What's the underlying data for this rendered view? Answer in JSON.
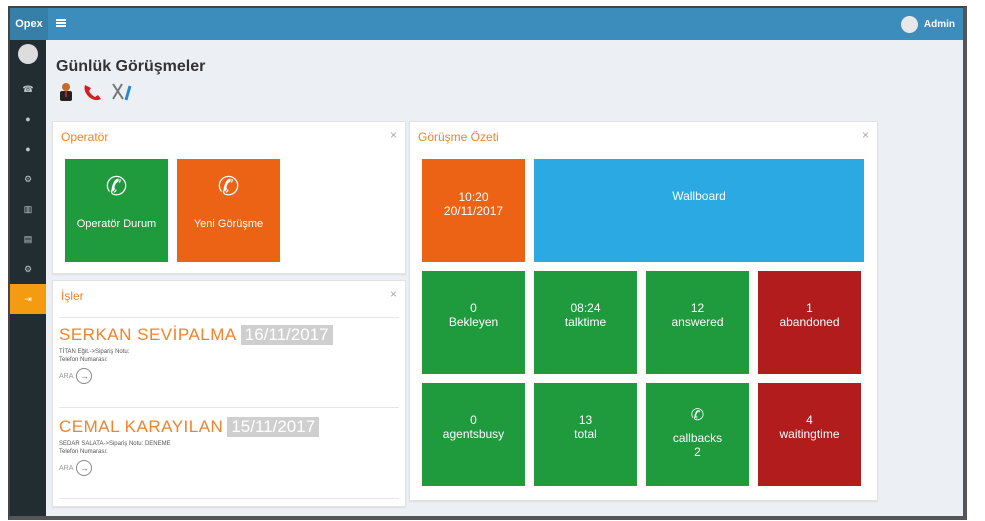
{
  "brand": "Opex",
  "user": {
    "name": "Admin"
  },
  "page": {
    "title": "Günlük Görüşmeler"
  },
  "operator_panel": {
    "title": "Operatör",
    "close": "×",
    "tiles": [
      {
        "label": "Operatör Durum",
        "icon": "phone-icon",
        "color": "#1f9a3d"
      },
      {
        "label": "Yeni Görüşme",
        "icon": "phone-icon",
        "color": "#ec6316"
      }
    ]
  },
  "jobs_panel": {
    "title": "İşler",
    "close": "×",
    "items": [
      {
        "name": "SERKAN SEVİPALMA",
        "date": "16/11/2017",
        "line1": "TİTAN Eğit.->Sipariş Notu:",
        "line2": "Telefon Numarası:",
        "action": "ARA"
      },
      {
        "name": "CEMAL KARAYILAN",
        "date": "15/11/2017",
        "line1": "SEDAR SALATA->Sipariş Notu: DENEME",
        "line2": "Telefon Numarası:",
        "action": "ARA"
      }
    ]
  },
  "summary_panel": {
    "title": "Görüşme Özeti",
    "close": "×",
    "time": "10:20",
    "date": "20/11/2017",
    "wallboard": "Wallboard",
    "stats": [
      {
        "value": "0",
        "label": "Bekleyen",
        "color": "#1f9a3d"
      },
      {
        "value": "08:24",
        "label": "talktime",
        "color": "#1f9a3d"
      },
      {
        "value": "12",
        "label": "answered",
        "color": "#1f9a3d"
      },
      {
        "value": "1",
        "label": "abandoned",
        "color": "#b21c1c"
      },
      {
        "value": "0",
        "label": "agentsbusy",
        "color": "#1f9a3d"
      },
      {
        "value": "13",
        "label": "total",
        "color": "#1f9a3d"
      },
      {
        "value": "2",
        "label": "callbacks",
        "color": "#1f9a3d",
        "icon": "phone-icon"
      },
      {
        "value": "4",
        "label": "waitingtime",
        "color": "#b21c1c"
      }
    ]
  },
  "sidebar": {
    "items": [
      {
        "icon": "phone-icon",
        "glyph": "☎"
      },
      {
        "icon": "user-icon",
        "glyph": "●"
      },
      {
        "icon": "user-icon",
        "glyph": "●"
      },
      {
        "icon": "gear-icon",
        "glyph": "⚙"
      },
      {
        "icon": "bank-icon",
        "glyph": "▥"
      },
      {
        "icon": "chart-icon",
        "glyph": "▤"
      },
      {
        "icon": "gear-icon",
        "glyph": "⚙"
      },
      {
        "icon": "sign-out-icon",
        "glyph": "⇥"
      }
    ]
  }
}
